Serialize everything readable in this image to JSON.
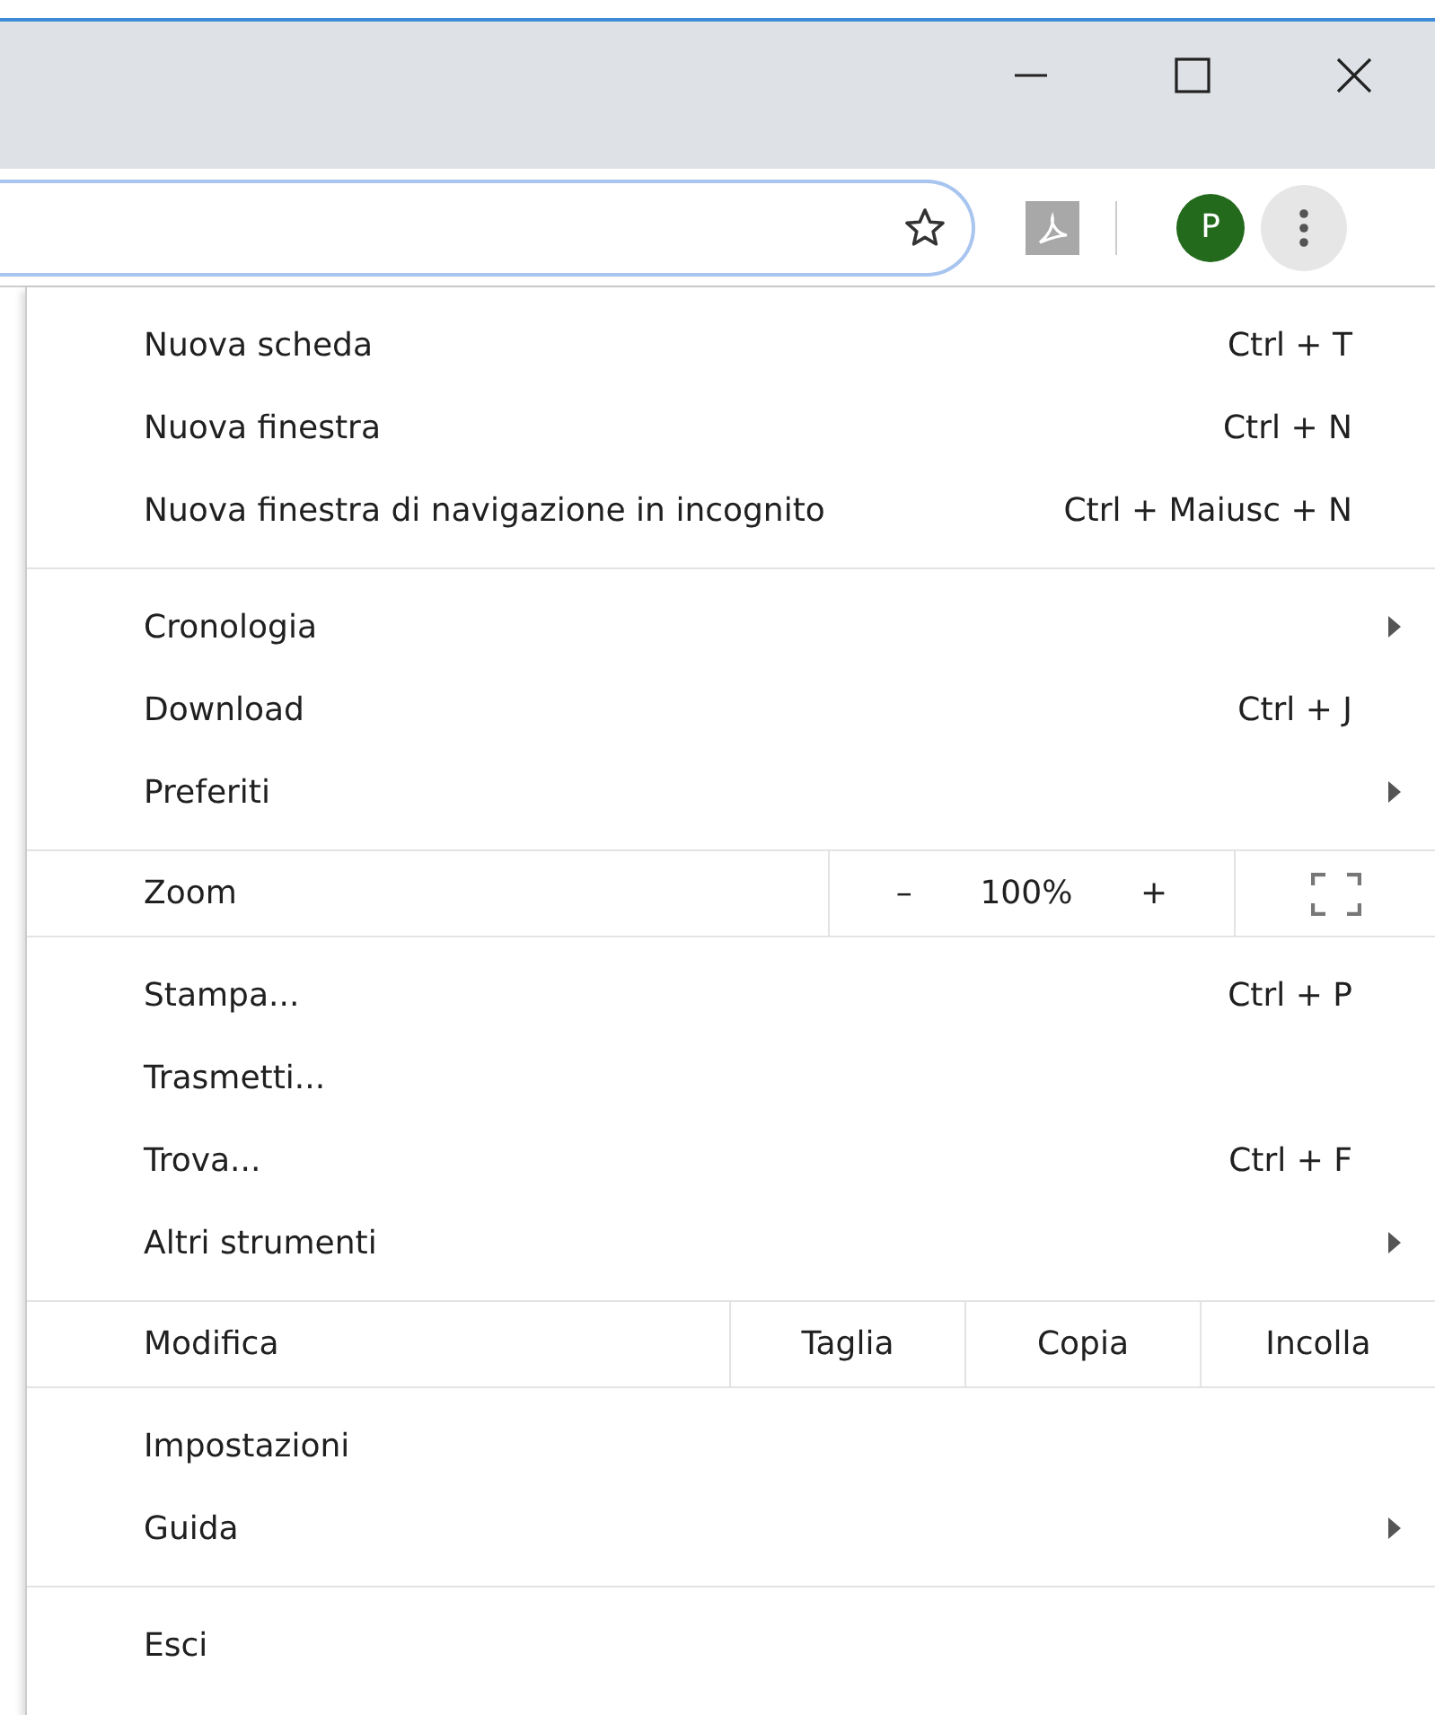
{
  "toolbar": {
    "avatar_letter": "P",
    "menu_open": true
  },
  "menu": {
    "sections": [
      {
        "items": [
          {
            "kind": "item",
            "label": "Nuova scheda",
            "shortcut": "Ctrl + T"
          },
          {
            "kind": "item",
            "label": "Nuova finestra",
            "shortcut": "Ctrl + N"
          },
          {
            "kind": "item",
            "label": "Nuova finestra di navigazione in incognito",
            "shortcut": "Ctrl + Maiusc + N"
          }
        ]
      },
      {
        "items": [
          {
            "kind": "submenu",
            "label": "Cronologia"
          },
          {
            "kind": "item",
            "label": "Download",
            "shortcut": "Ctrl + J"
          },
          {
            "kind": "submenu",
            "label": "Preferiti"
          }
        ]
      },
      {
        "items": [
          {
            "kind": "zoom",
            "label": "Zoom",
            "minus": "–",
            "value": "100%",
            "plus": "+"
          }
        ]
      },
      {
        "items": [
          {
            "kind": "item",
            "label": "Stampa...",
            "shortcut": "Ctrl + P"
          },
          {
            "kind": "item",
            "label": "Trasmetti..."
          },
          {
            "kind": "item",
            "label": "Trova...",
            "shortcut": "Ctrl + F"
          },
          {
            "kind": "submenu",
            "label": "Altri strumenti"
          }
        ]
      },
      {
        "items": [
          {
            "kind": "edit",
            "label": "Modifica",
            "actions": [
              "Taglia",
              "Copia",
              "Incolla"
            ]
          }
        ]
      },
      {
        "items": [
          {
            "kind": "item",
            "label": "Impostazioni"
          },
          {
            "kind": "submenu",
            "label": "Guida"
          }
        ]
      },
      {
        "items": [
          {
            "kind": "item",
            "label": "Esci"
          }
        ]
      }
    ]
  }
}
